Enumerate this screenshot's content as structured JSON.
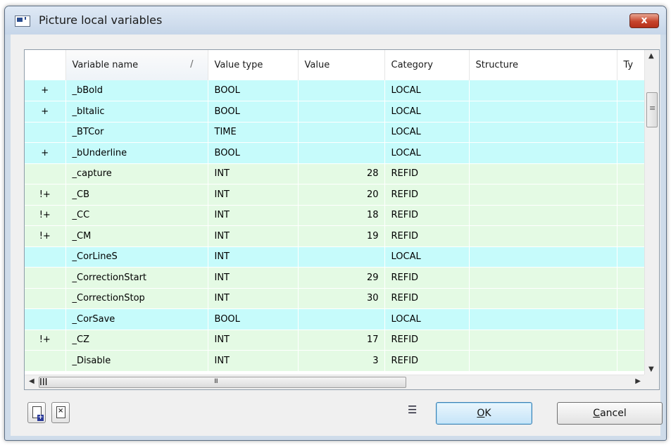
{
  "window": {
    "title": "Picture local variables",
    "close_glyph": "x"
  },
  "table": {
    "columns": [
      "",
      "Variable name",
      "Value type",
      "Value",
      "Category",
      "Structure",
      "Ty"
    ],
    "sort_indicator": "/",
    "rows": [
      {
        "marker": "+",
        "name": "_bBold",
        "type": "BOOL",
        "value": "",
        "category": "LOCAL"
      },
      {
        "marker": "+",
        "name": "_bItalic",
        "type": "BOOL",
        "value": "",
        "category": "LOCAL"
      },
      {
        "marker": "",
        "name": "_BTCor",
        "type": "TIME",
        "value": "",
        "category": "LOCAL"
      },
      {
        "marker": "+",
        "name": "_bUnderline",
        "type": "BOOL",
        "value": "",
        "category": "LOCAL"
      },
      {
        "marker": "",
        "name": "_capture",
        "type": "INT",
        "value": "28",
        "category": "REFID"
      },
      {
        "marker": "!+",
        "name": "_CB",
        "type": "INT",
        "value": "20",
        "category": "REFID"
      },
      {
        "marker": "!+",
        "name": "_CC",
        "type": "INT",
        "value": "18",
        "category": "REFID"
      },
      {
        "marker": "!+",
        "name": "_CM",
        "type": "INT",
        "value": "19",
        "category": "REFID"
      },
      {
        "marker": "",
        "name": "_CorLineS",
        "type": "INT",
        "value": "",
        "category": "LOCAL"
      },
      {
        "marker": "",
        "name": "_CorrectionStart",
        "type": "INT",
        "value": "29",
        "category": "REFID"
      },
      {
        "marker": "",
        "name": "_CorrectionStop",
        "type": "INT",
        "value": "30",
        "category": "REFID"
      },
      {
        "marker": "",
        "name": "_CorSave",
        "type": "BOOL",
        "value": "",
        "category": "LOCAL"
      },
      {
        "marker": "!+",
        "name": "_CZ",
        "type": "INT",
        "value": "17",
        "category": "REFID"
      },
      {
        "marker": "",
        "name": "_Disable",
        "type": "INT",
        "value": "3",
        "category": "REFID"
      }
    ]
  },
  "scrollbar": {
    "grip_label": "III"
  },
  "buttons": {
    "ok": {
      "mnemonic": "O",
      "rest": "K"
    },
    "cancel": {
      "mnemonic": "C",
      "rest": "ancel"
    }
  },
  "icons": {
    "new": "new-variable-icon",
    "delete": "delete-variable-icon",
    "list": "list-options-icon"
  },
  "colors": {
    "local_row": "#c6fbfb",
    "refid_row": "#e4fae4",
    "ok_border": "#3c7fb1"
  }
}
